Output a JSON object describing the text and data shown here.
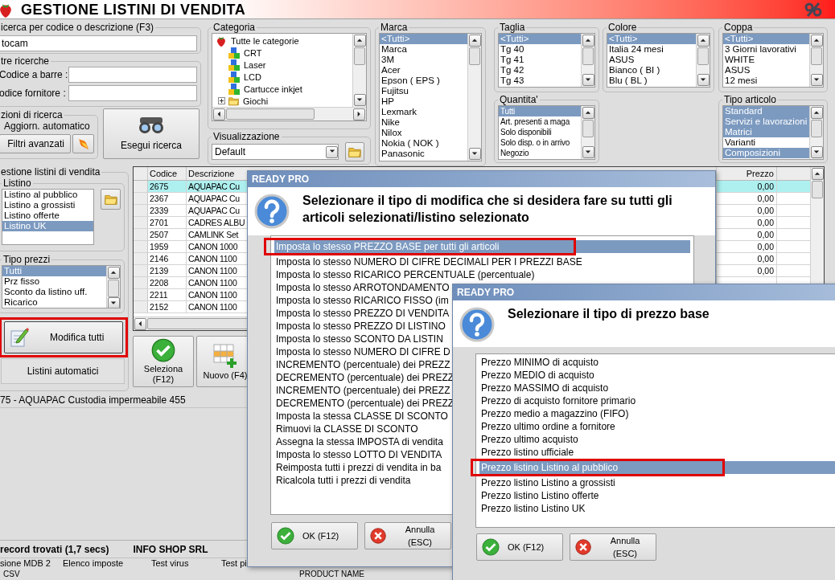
{
  "window": {
    "title": "GESTIONE LISTINI DI VENDITA"
  },
  "search": {
    "label": "icerca per codice o descrizione (F3)",
    "value": "tocam"
  },
  "other_searches": {
    "label": "tre ricerche",
    "fields": [
      {
        "label": "Codice a barre :"
      },
      {
        "label": "odice fornitore :"
      }
    ]
  },
  "search_options": {
    "label": "zioni di ricerca",
    "auto_update": "Aggiorn. automatico",
    "advanced_filters": "Filtri avanzati"
  },
  "run_search_button": "Esegui ricerca",
  "categoria": {
    "label": "Categoria",
    "tree": [
      {
        "label": "Tutte le categorie",
        "children": [
          {
            "label": "CRT"
          },
          {
            "label": "Laser"
          },
          {
            "label": "LCD"
          },
          {
            "label": "Cartucce inkjet"
          },
          {
            "label": "Giochi",
            "expanded": false
          }
        ]
      }
    ]
  },
  "visualizzazione": {
    "label": "Visualizzazione",
    "value": "Default"
  },
  "marca": {
    "label": "Marca",
    "items": [
      {
        "label": "<Tutti>",
        "selected": true
      },
      {
        "label": "Marca",
        "selected": false
      },
      {
        "label": "3M",
        "selected": false
      },
      {
        "label": "Acer",
        "selected": false
      },
      {
        "label": "Epson ( EPS )",
        "selected": false
      },
      {
        "label": "Fujitsu",
        "selected": false
      },
      {
        "label": "HP",
        "selected": false
      },
      {
        "label": "Lexmark",
        "selected": false
      },
      {
        "label": "Nike",
        "selected": false
      },
      {
        "label": "Nilox",
        "selected": false
      },
      {
        "label": "Nokia ( NOK )",
        "selected": false
      },
      {
        "label": "Panasonic",
        "selected": false
      }
    ]
  },
  "taglia": {
    "label": "Taglia",
    "items": [
      {
        "label": "<Tutti>",
        "selected": true
      },
      {
        "label": "Tg 40",
        "selected": false
      },
      {
        "label": "Tg 41",
        "selected": false
      },
      {
        "label": "Tg 42",
        "selected": false
      },
      {
        "label": "Tg 43",
        "selected": false
      }
    ]
  },
  "quantita": {
    "label": "Quantita'",
    "items": [
      {
        "label": "Tutti",
        "selected": true
      },
      {
        "label": "Art. presenti a maga",
        "selected": false
      },
      {
        "label": "Solo disponibili",
        "selected": false
      },
      {
        "label": "Solo disp. o in arrivo",
        "selected": false
      },
      {
        "label": "Negozio",
        "selected": false
      }
    ]
  },
  "colore": {
    "label": "Colore",
    "items": [
      {
        "label": "<Tutti>",
        "selected": true
      },
      {
        "label": "Italia 24 mesi",
        "selected": false
      },
      {
        "label": "ASUS",
        "selected": false
      },
      {
        "label": "Bianco ( BI )",
        "selected": false
      },
      {
        "label": "Blu ( BL )",
        "selected": false
      }
    ]
  },
  "coppa": {
    "label": "Coppa",
    "items": [
      {
        "label": "<Tutti>",
        "selected": true
      },
      {
        "label": "3 Giorni lavorativi",
        "selected": false
      },
      {
        "label": "WHITE",
        "selected": false
      },
      {
        "label": "ASUS",
        "selected": false
      },
      {
        "label": "12 mesi",
        "selected": false
      }
    ]
  },
  "tipo_articolo": {
    "label": "Tipo articolo",
    "items": [
      {
        "label": "Standard",
        "selected": true
      },
      {
        "label": "Servizi e lavorazioni",
        "selected": true
      },
      {
        "label": "Matrici",
        "selected": true
      },
      {
        "label": "Varianti",
        "selected": false
      },
      {
        "label": "Composizioni",
        "selected": true
      }
    ]
  },
  "price_lists": {
    "label": "estione listini di vendita",
    "listino": {
      "label": "Listino",
      "items": [
        {
          "label": "Listino al pubblico",
          "selected": false
        },
        {
          "label": "Listino a grossisti",
          "selected": false
        },
        {
          "label": "Listino offerte",
          "selected": false
        },
        {
          "label": "Listino UK",
          "selected": true
        }
      ]
    },
    "tipo_prezzi": {
      "label": "Tipo prezzi",
      "items": [
        {
          "label": "Tutti",
          "selected": true
        },
        {
          "label": "Prz fisso",
          "selected": false
        },
        {
          "label": "Sconto da listino uff.",
          "selected": false
        },
        {
          "label": "Ricarico",
          "selected": false
        }
      ]
    },
    "edit_all": {
      "label": "Modifica tutti",
      "highlighted": true
    },
    "auto_lists": "Listini automatici"
  },
  "table": {
    "columns": [
      "Codice",
      "Descrizione",
      "Prezzo"
    ],
    "rows": [
      {
        "codice": "2675",
        "descrizione": "AQUAPAC Cu",
        "prezzo": "0,00",
        "selected": true
      },
      {
        "codice": "2367",
        "descrizione": "AQUAPAC Cu",
        "prezzo": "0,00",
        "selected": false
      },
      {
        "codice": "2339",
        "descrizione": "AQUAPAC Cu",
        "prezzo": "0,00",
        "selected": false
      },
      {
        "codice": "2701",
        "descrizione": "CADRES ALBU",
        "prezzo": "0,00",
        "selected": false
      },
      {
        "codice": "2507",
        "descrizione": "CAMLINK Set",
        "prezzo": "0,00",
        "selected": false
      },
      {
        "codice": "1959",
        "descrizione": "CANON 1000",
        "prezzo": "0,00",
        "selected": false
      },
      {
        "codice": "2146",
        "descrizione": "CANON 1100",
        "prezzo": "0,00",
        "selected": false
      },
      {
        "codice": "2139",
        "descrizione": "CANON 1100",
        "prezzo": "0,00",
        "selected": false
      },
      {
        "codice": "2208",
        "descrizione": "CANON 1100",
        "selected": false
      },
      {
        "codice": "2211",
        "descrizione": "CANON 1100",
        "selected": false
      },
      {
        "codice": "2152",
        "descrizione": "CANON 1100",
        "selected": false
      }
    ]
  },
  "actions": [
    {
      "label": "Seleziona (F12)",
      "kind": "select"
    },
    {
      "label": "Nuovo (F4)",
      "kind": "new"
    }
  ],
  "current_item": "75 - AQUAPAC Custodia impermeabile 455",
  "status_bar": [
    "record trovati (1,7 secs)",
    "INFO SHOP SRL"
  ],
  "footer_links": [
    "sione MDB 2",
    "Elenco imposte",
    "Test virus",
    "Test pi"
  ],
  "footer_row_2": [
    "CSV",
    "PRODUCT NAME"
  ],
  "dialogs": [
    {
      "title": "READY PRO",
      "message": "Selezionare il tipo di modifica che si desidera fare su tutti gli articoli selezionati/listino selezionato",
      "items": [
        {
          "label": "Imposta lo stesso PREZZO BASE per tutti gli articoli",
          "selected": true,
          "highlighted": true
        },
        {
          "label": "Imposta lo stesso NUMERO DI CIFRE DECIMALI PER I PREZZI BASE",
          "selected": false,
          "highlighted": false
        },
        {
          "label": "Imposta lo stesso RICARICO PERCENTUALE (percentuale)",
          "selected": false,
          "highlighted": false
        },
        {
          "label": "Imposta lo stesso ARROTONDAMENTO",
          "selected": false,
          "highlighted": false
        },
        {
          "label": "Imposta lo stesso RICARICO FISSO (im",
          "selected": false,
          "highlighted": false
        },
        {
          "label": "Imposta lo stesso PREZZO DI VENDITA",
          "selected": false,
          "highlighted": false
        },
        {
          "label": "Imposta lo stesso PREZZO DI LISTINO",
          "selected": false,
          "highlighted": false
        },
        {
          "label": "Imposta lo stesso SCONTO DA LISTIN",
          "selected": false,
          "highlighted": false
        },
        {
          "label": "Imposta lo stesso NUMERO DI CIFRE D",
          "selected": false,
          "highlighted": false
        },
        {
          "label": "INCREMENTO (percentuale) dei PREZZ",
          "selected": false,
          "highlighted": false
        },
        {
          "label": "DECREMENTO (percentuale) dei PREZZ",
          "selected": false,
          "highlighted": false
        },
        {
          "label": "INCREMENTO (percentuale) dei PREZZ",
          "selected": false,
          "highlighted": false
        },
        {
          "label": "DECREMENTO (percentuale) dei PREZZ",
          "selected": false,
          "highlighted": false
        },
        {
          "label": "Imposta la stessa CLASSE DI SCONTO",
          "selected": false,
          "highlighted": false
        },
        {
          "label": "Rimuovi la CLASSE DI SCONTO",
          "selected": false,
          "highlighted": false
        },
        {
          "label": "Assegna la stessa IMPOSTA di vendita",
          "selected": false,
          "highlighted": false
        },
        {
          "label": "Imposta lo stesso LOTTO DI VENDITA",
          "selected": false,
          "highlighted": false
        },
        {
          "label": "Reimposta tutti i prezzi di vendita in ba",
          "selected": false,
          "highlighted": false
        },
        {
          "label": "Ricalcola tutti i prezzi di vendita",
          "selected": false,
          "highlighted": false
        }
      ],
      "buttons": [
        {
          "label": "OK (F12)",
          "kind": "ok"
        },
        {
          "label": "Annulla (ESC)",
          "kind": "cancel"
        }
      ]
    },
    {
      "title": "READY PRO",
      "message": "Selezionare il tipo di prezzo base",
      "items": [
        {
          "label": "Prezzo MINIMO di acquisto",
          "selected": false,
          "highlighted": false
        },
        {
          "label": "Prezzo MEDIO di acquisto",
          "selected": false,
          "highlighted": false
        },
        {
          "label": "Prezzo MASSIMO di acquisto",
          "selected": false,
          "highlighted": false
        },
        {
          "label": "Prezzo di acquisto fornitore primario",
          "selected": false,
          "highlighted": false
        },
        {
          "label": "Prezzo medio a magazzino (FIFO)",
          "selected": false,
          "highlighted": false
        },
        {
          "label": "Prezzo ultimo ordine a fornitore",
          "selected": false,
          "highlighted": false
        },
        {
          "label": "Prezzo ultimo acquisto",
          "selected": false,
          "highlighted": false
        },
        {
          "label": "Prezzo listino ufficiale",
          "selected": false,
          "highlighted": false
        },
        {
          "label": "Prezzo listino Listino al pubblico",
          "selected": true,
          "highlighted": true
        },
        {
          "label": "Prezzo listino Listino a grossisti",
          "selected": false,
          "highlighted": false
        },
        {
          "label": "Prezzo listino Listino offerte",
          "selected": false,
          "highlighted": false
        },
        {
          "label": "Prezzo listino Listino UK",
          "selected": false,
          "highlighted": false
        }
      ],
      "buttons": [
        {
          "label": "OK (F12)",
          "kind": "ok"
        },
        {
          "label": "Annulla (ESC)",
          "kind": "cancel"
        }
      ]
    }
  ]
}
